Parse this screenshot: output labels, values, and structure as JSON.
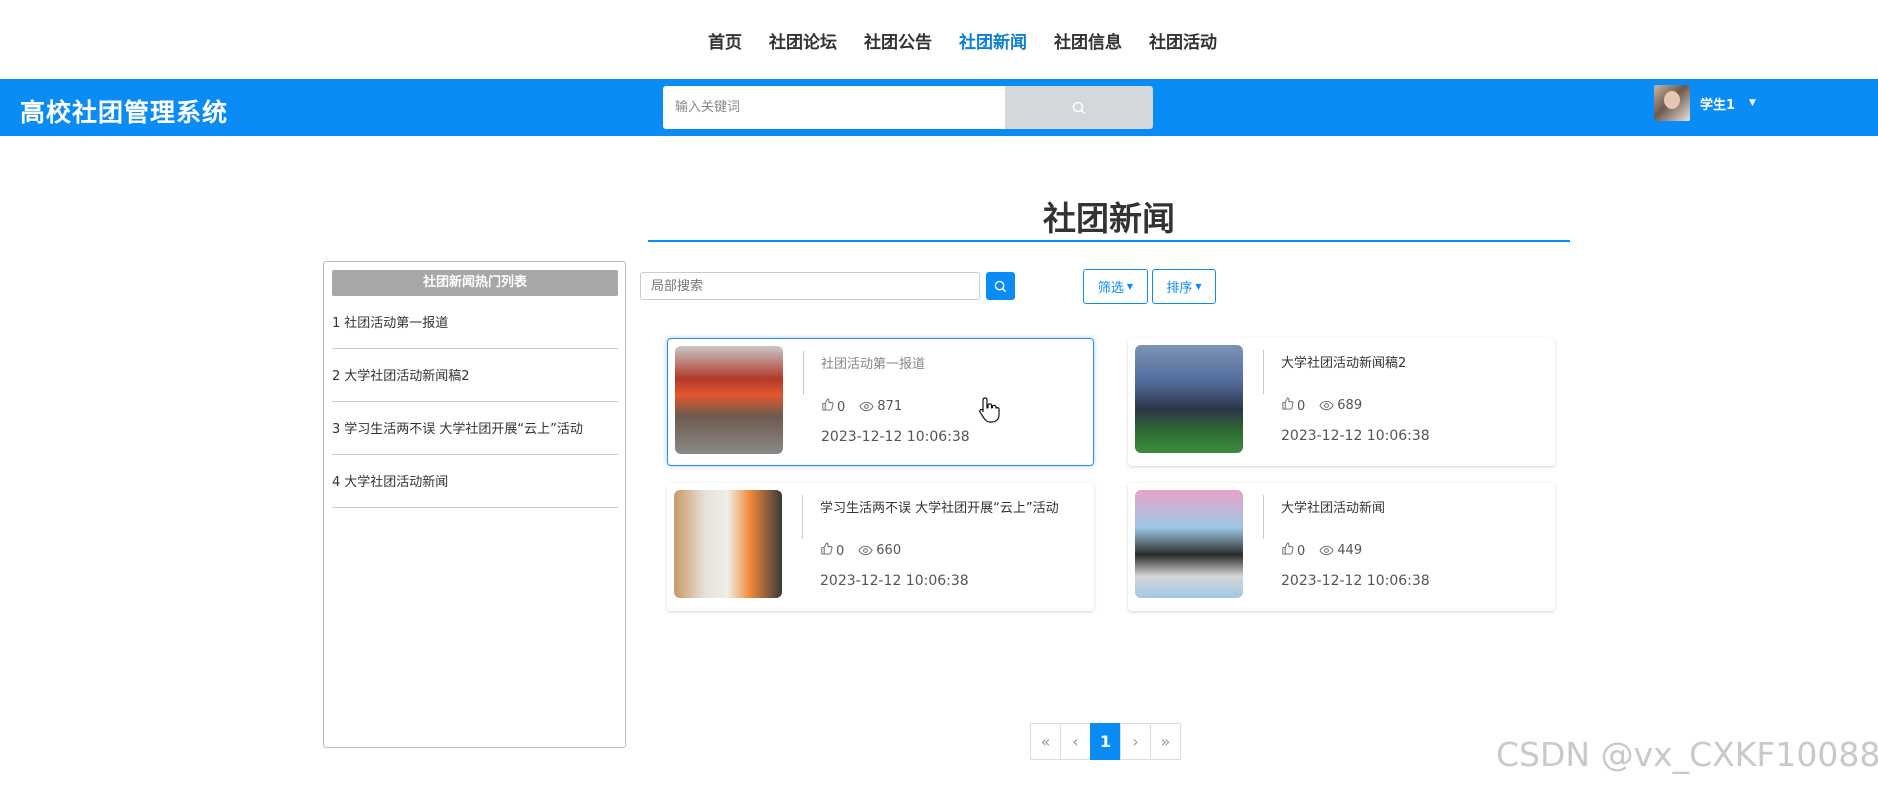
{
  "nav": {
    "items": [
      {
        "label": "首页",
        "active": false
      },
      {
        "label": "社团论坛",
        "active": false
      },
      {
        "label": "社团公告",
        "active": false
      },
      {
        "label": "社团新闻",
        "active": true
      },
      {
        "label": "社团信息",
        "active": false
      },
      {
        "label": "社团活动",
        "active": false
      }
    ]
  },
  "header": {
    "brand": "高校社团管理系统",
    "search_placeholder": "输入关键词",
    "search_icon": "search-icon",
    "user_name": "学生1",
    "caret_icon": "caret-down-icon"
  },
  "page": {
    "title": "社团新闻"
  },
  "sidebar": {
    "heading": "社团新闻热门列表",
    "items": [
      {
        "num": "1",
        "text": "社团活动第一报道"
      },
      {
        "num": "2",
        "text": "大学社团活动新闻稿2"
      },
      {
        "num": "3",
        "text": "学习生活两不误 大学社团开展“云上”活动"
      },
      {
        "num": "4",
        "text": "大学社团活动新闻"
      }
    ]
  },
  "toolbar": {
    "local_search_placeholder": "局部搜索",
    "filter_label": "筛选",
    "sort_label": "排序"
  },
  "cards": [
    {
      "title": "社团活动第一报道",
      "likes": "0",
      "views": "871",
      "date": "2023-12-12 10:06:38"
    },
    {
      "title": "大学社团活动新闻稿2",
      "likes": "0",
      "views": "689",
      "date": "2023-12-12 10:06:38"
    },
    {
      "title": "学习生活两不误 大学社团开展“云上”活动",
      "likes": "0",
      "views": "660",
      "date": "2023-12-12 10:06:38"
    },
    {
      "title": "大学社团活动新闻",
      "likes": "0",
      "views": "449",
      "date": "2023-12-12 10:06:38"
    }
  ],
  "pagination": {
    "first": "«",
    "prev": "‹",
    "current": "1",
    "next": "›",
    "last": "»"
  },
  "watermark": "CSDN @vx_CXKF10088",
  "colors": {
    "primary": "#0a8cf7",
    "active_nav": "#0e7fd6"
  }
}
